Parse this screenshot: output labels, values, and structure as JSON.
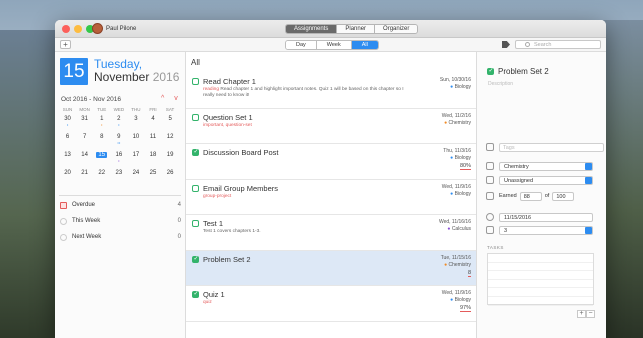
{
  "window": {
    "user_name": "Paul Pilone",
    "main_tabs": [
      "Assignments",
      "Planner",
      "Organizer"
    ],
    "active_main_tab": "Assignments"
  },
  "toolbar": {
    "add_label": "+",
    "view_tabs": [
      "Day",
      "Week",
      "All"
    ],
    "active_view": "All",
    "search_placeholder": "Search"
  },
  "sidebar": {
    "day_number": "15",
    "day_of_week": "Tuesday,",
    "month": "November",
    "year": "2016",
    "range_label": "Oct 2016 - Nov 2016",
    "nav_arrows": "^ v",
    "weekdays": [
      "SUN",
      "MON",
      "TUE",
      "WED",
      "THU",
      "FRI",
      "SAT"
    ],
    "weeks": [
      [
        {
          "d": "30",
          "dots": "•",
          "dot_color": "blue"
        },
        {
          "d": "31",
          "dots": "",
          "dot_color": ""
        },
        {
          "d": "1",
          "dots": "•",
          "dot_color": "orange"
        },
        {
          "d": "2",
          "dots": "•",
          "dot_color": "blue"
        },
        {
          "d": "3",
          "dots": "",
          "dot_color": ""
        },
        {
          "d": "4",
          "dots": "",
          "dot_color": ""
        },
        {
          "d": "5",
          "dots": "",
          "dot_color": ""
        }
      ],
      [
        {
          "d": "6",
          "dots": "",
          "dot_color": ""
        },
        {
          "d": "7",
          "dots": "",
          "dot_color": ""
        },
        {
          "d": "8",
          "dots": "",
          "dot_color": ""
        },
        {
          "d": "9",
          "dots": "••",
          "dot_color": "blue"
        },
        {
          "d": "10",
          "dots": "",
          "dot_color": ""
        },
        {
          "d": "11",
          "dots": "",
          "dot_color": ""
        },
        {
          "d": "12",
          "dots": "",
          "dot_color": ""
        }
      ],
      [
        {
          "d": "13",
          "dots": "",
          "dot_color": ""
        },
        {
          "d": "14",
          "dots": "",
          "dot_color": ""
        },
        {
          "d": "15",
          "dots": "",
          "dot_color": "",
          "today": true
        },
        {
          "d": "16",
          "dots": "•",
          "dot_color": "purple"
        },
        {
          "d": "17",
          "dots": "",
          "dot_color": ""
        },
        {
          "d": "18",
          "dots": "",
          "dot_color": ""
        },
        {
          "d": "19",
          "dots": "",
          "dot_color": ""
        }
      ],
      [
        {
          "d": "20",
          "dots": "",
          "dot_color": ""
        },
        {
          "d": "21",
          "dots": "",
          "dot_color": ""
        },
        {
          "d": "22",
          "dots": "",
          "dot_color": ""
        },
        {
          "d": "23",
          "dots": "",
          "dot_color": ""
        },
        {
          "d": "24",
          "dots": "",
          "dot_color": ""
        },
        {
          "d": "25",
          "dots": "",
          "dot_color": ""
        },
        {
          "d": "26",
          "dots": "",
          "dot_color": ""
        }
      ]
    ],
    "filters": [
      {
        "label": "Overdue",
        "count": "4",
        "kind": "overdue"
      },
      {
        "label": "This Week",
        "count": "0",
        "kind": "week"
      },
      {
        "label": "Next Week",
        "count": "0",
        "kind": "week"
      }
    ]
  },
  "list": {
    "heading": "All",
    "tasks": [
      {
        "title": "Read Chapter 1",
        "tag": "reading",
        "note": "Read chapter 1 and highlight important notes. Quiz 1 will be based on this chapter so I really need to know it!",
        "date": "Sun, 10/30/16",
        "course": "Biology",
        "course_color": "blue",
        "grade": "",
        "done": false,
        "selected": false
      },
      {
        "title": "Question Set 1",
        "tag": "important, question-set",
        "note": "",
        "date": "Wed, 11/2/16",
        "course": "Chemistry",
        "course_color": "orange",
        "grade": "",
        "done": false,
        "selected": false
      },
      {
        "title": "Discussion Board Post",
        "tag": "",
        "note": "",
        "date": "Thu, 11/3/16",
        "course": "Biology",
        "course_color": "blue",
        "grade": "80%",
        "done": true,
        "selected": false
      },
      {
        "title": "Email Group Members",
        "tag": "group-project",
        "note": "",
        "date": "Wed, 11/9/16",
        "course": "Biology",
        "course_color": "blue",
        "grade": "",
        "done": false,
        "selected": false
      },
      {
        "title": "Test 1",
        "tag": "",
        "note": "Test 1 covers chapters 1-3.",
        "date": "Wed, 11/16/16",
        "course": "Calculus",
        "course_color": "purple",
        "grade": "",
        "done": false,
        "selected": false
      },
      {
        "title": "Problem Set 2",
        "tag": "",
        "note": "",
        "date": "Tue, 11/15/16",
        "course": "Chemistry",
        "course_color": "orange",
        "grade": "8",
        "done": true,
        "selected": true
      },
      {
        "title": "Quiz 1",
        "tag": "quiz",
        "note": "",
        "date": "Wed, 11/9/16",
        "course": "Biology",
        "course_color": "blue",
        "grade": "97%",
        "done": true,
        "selected": false
      }
    ]
  },
  "detail": {
    "title": "Problem Set 2",
    "description_placeholder": "Description",
    "tags_placeholder": "Tags",
    "course": "Chemistry",
    "category": "Unassigned",
    "earned_label": "Earned",
    "earned": "88",
    "of_label": "of",
    "total": "100",
    "due_date": "11/15/2016",
    "priority": "3",
    "tasks_label": "TASKS",
    "add_label": "+",
    "remove_label": "−"
  },
  "colors": {
    "accent": "#2d8cf0",
    "done": "#33b36b",
    "tag": "#e45b5b",
    "blue": "#2d8cf0",
    "orange": "#f08a24",
    "purple": "#8a4fd6"
  }
}
